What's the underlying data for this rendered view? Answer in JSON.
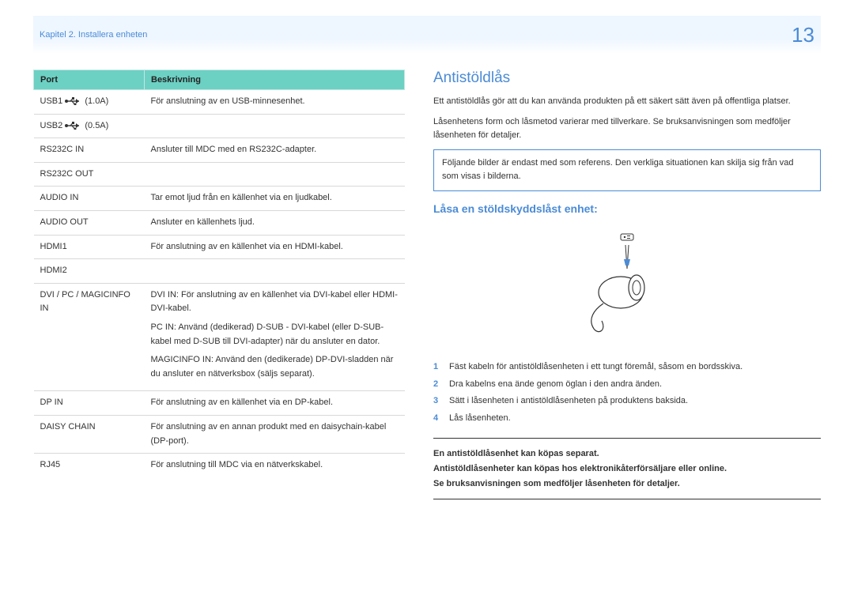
{
  "breadcrumb": "Kapitel 2. Installera enheten",
  "page_number": "13",
  "table": {
    "headers": {
      "port": "Port",
      "desc": "Beskrivning"
    },
    "rows": [
      {
        "port_prefix": "USB1",
        "port_suffix": "(1.0A)",
        "has_usb_icon": true,
        "desc": "För anslutning av en USB-minnesenhet."
      },
      {
        "port_prefix": "USB2",
        "port_suffix": "(0.5A)",
        "has_usb_icon": true,
        "desc": ""
      },
      {
        "port": "RS232C IN",
        "desc": "Ansluter till MDC med en RS232C-adapter."
      },
      {
        "port": "RS232C OUT",
        "desc": ""
      },
      {
        "port": "AUDIO IN",
        "desc": "Tar emot ljud från en källenhet via en ljudkabel."
      },
      {
        "port": "AUDIO OUT",
        "desc": "Ansluter en källenhets ljud."
      },
      {
        "port": "HDMI1",
        "desc": "För anslutning av en källenhet via en HDMI-kabel."
      },
      {
        "port": "HDMI2",
        "desc": ""
      },
      {
        "port": "DVI / PC / MAGICINFO IN",
        "desc_multi": [
          "DVI IN: För anslutning av en källenhet via DVI-kabel eller HDMI-DVI-kabel.",
          "PC IN: Använd (dedikerad) D-SUB - DVI-kabel (eller D-SUB-kabel med D-SUB till DVI-adapter) när du ansluter en dator.",
          "MAGICINFO IN: Använd den (dedikerade) DP-DVI-sladden när du ansluter en nätverksbox (säljs separat)."
        ]
      },
      {
        "port": "DP IN",
        "desc": "För anslutning av en källenhet via en DP-kabel."
      },
      {
        "port": "DAISY CHAIN",
        "desc": "För anslutning av en annan produkt med en daisychain-kabel (DP-port)."
      },
      {
        "port": "RJ45",
        "desc": "För anslutning till MDC via en nätverkskabel."
      }
    ]
  },
  "right": {
    "title": "Antistöldlås",
    "intro1": "Ett antistöldlås gör att du kan använda produkten på ett säkert sätt även på offentliga platser.",
    "intro2": "Låsenhetens form och låsmetod varierar med tillverkare. Se bruksanvisningen som medföljer låsenheten för detaljer.",
    "note": "Följande bilder är endast med som referens. Den verkliga situationen kan skilja sig från vad som visas i bilderna.",
    "subtitle": "Låsa en stöldskyddslåst enhet:",
    "steps": [
      "Fäst kabeln för antistöldlåsenheten i ett tungt föremål, såsom en bordsskiva.",
      "Dra kabelns ena ände genom öglan i den andra änden.",
      "Sätt i låsenheten i antistöldlåsenheten på produktens baksida.",
      "Lås låsenheten."
    ],
    "bottom_note": {
      "l1": "En antistöldlåsenhet kan köpas separat.",
      "l2": "Antistöldlåsenheter kan köpas hos elektronikåterförsäljare eller online.",
      "l3": "Se bruksanvisningen som medföljer låsenheten för detaljer."
    }
  }
}
